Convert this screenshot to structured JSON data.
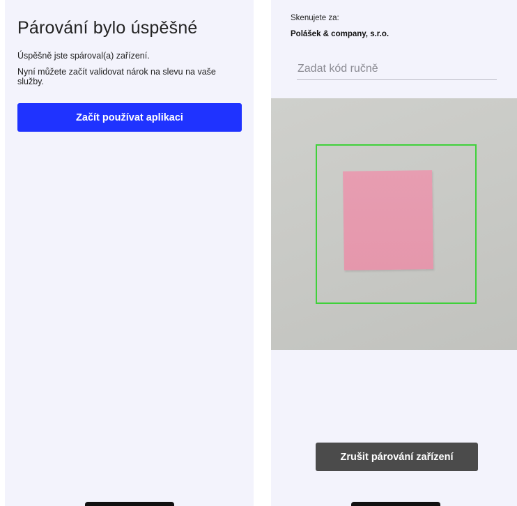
{
  "pairing_screen": {
    "title": "Párování bylo úspěšné",
    "line1": "Úspěšně jste spároval(a) zařízení.",
    "line2": "Nyní můžete začít validovat nárok na slevu na vaše služby.",
    "start_button_label": "Začít používat aplikaci"
  },
  "scan_screen": {
    "scanning_for_label": "Skenujete za:",
    "company_name": "Polášek & company, s.r.o.",
    "code_input": {
      "placeholder": "Zadat kód ručně",
      "value": ""
    },
    "cancel_button_label": "Zrušit párování zařízení"
  },
  "colors": {
    "background": "#f3f3fc",
    "primary_button": "#1f33ff",
    "secondary_button": "#4b4b4b",
    "scan_frame": "#3fd13a",
    "sticky_note": "#e79db1"
  }
}
